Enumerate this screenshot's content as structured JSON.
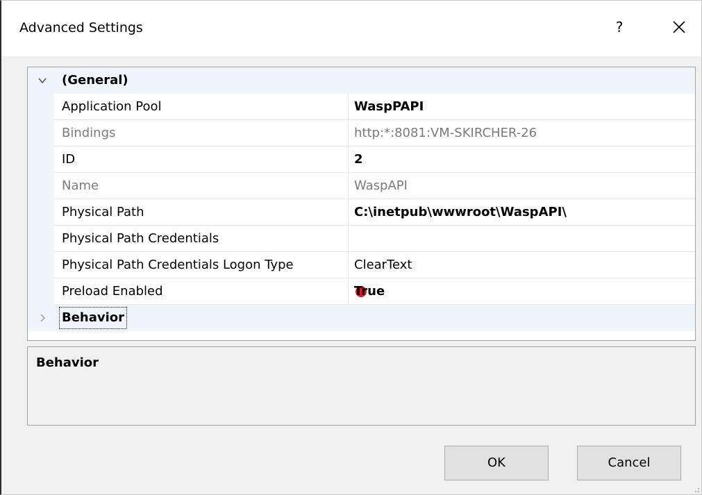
{
  "window": {
    "title": "Advanced Settings",
    "help_label": "?",
    "close_icon": "close-icon"
  },
  "grid": {
    "categories": [
      {
        "label": "(General)",
        "expanded": true,
        "properties": [
          {
            "name": "Application Pool",
            "value": "WaspPAPI",
            "bold": true,
            "disabled": false
          },
          {
            "name": "Bindings",
            "value": "http:*:8081:VM-SKIRCHER-26",
            "bold": false,
            "disabled": true
          },
          {
            "name": "ID",
            "value": "2",
            "bold": true,
            "disabled": false
          },
          {
            "name": "Name",
            "value": "WaspAPI",
            "bold": false,
            "disabled": true
          },
          {
            "name": "Physical Path",
            "value": "C:\\inetpub\\wwwroot\\WaspAPI\\",
            "bold": true,
            "disabled": false
          },
          {
            "name": "Physical Path Credentials",
            "value": "",
            "bold": false,
            "disabled": false
          },
          {
            "name": "Physical Path Credentials Logon Type",
            "value": "ClearText",
            "bold": false,
            "disabled": false
          },
          {
            "name": "Preload Enabled",
            "value": "True",
            "bold": true,
            "disabled": false,
            "marker_color": "#e8121a"
          }
        ]
      },
      {
        "label": "Behavior",
        "expanded": false
      }
    ]
  },
  "description": {
    "title": "Behavior"
  },
  "buttons": {
    "ok_label": "OK",
    "cancel_label": "Cancel"
  }
}
